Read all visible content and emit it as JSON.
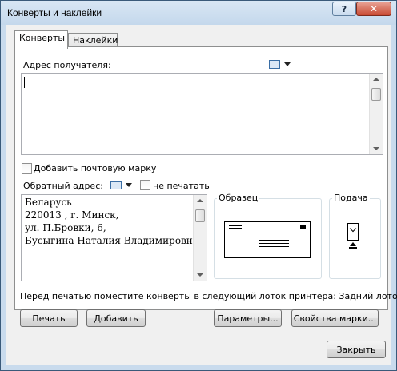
{
  "window": {
    "title": "Конверты и наклейки",
    "help_glyph": "?",
    "close_glyph": "✕"
  },
  "tabs": [
    {
      "label": "Конверты",
      "active": true
    },
    {
      "label": "Наклейки",
      "active": false
    }
  ],
  "recipient": {
    "label": "Адрес получателя:",
    "value": "",
    "address_book_icon": "address-book-icon"
  },
  "add_postage": {
    "label": "Добавить почтовую марку",
    "checked": false
  },
  "return_address": {
    "label": "Обратный адрес:",
    "omit_label": "не печатать",
    "omit_checked": false,
    "lines": [
      "Беларусь",
      "220013 , г. Минск,",
      "ул. П.Бровки, 6,",
      "Бусыгина Наталия Владимировна"
    ]
  },
  "preview": {
    "label": "Образец"
  },
  "feed": {
    "label": "Подача"
  },
  "info_text": "Перед печатью поместите конверты в следующий лоток принтера: Задний лоток.",
  "buttons": {
    "print": "Печать",
    "add": "Добавить",
    "options": "Параметры...",
    "epostage": "Свойства марки...",
    "close": "Закрыть"
  },
  "colors": {
    "window_frame": "#c9dbed",
    "client_bg": "#f0f0f0",
    "close_button": "#c84a33"
  }
}
